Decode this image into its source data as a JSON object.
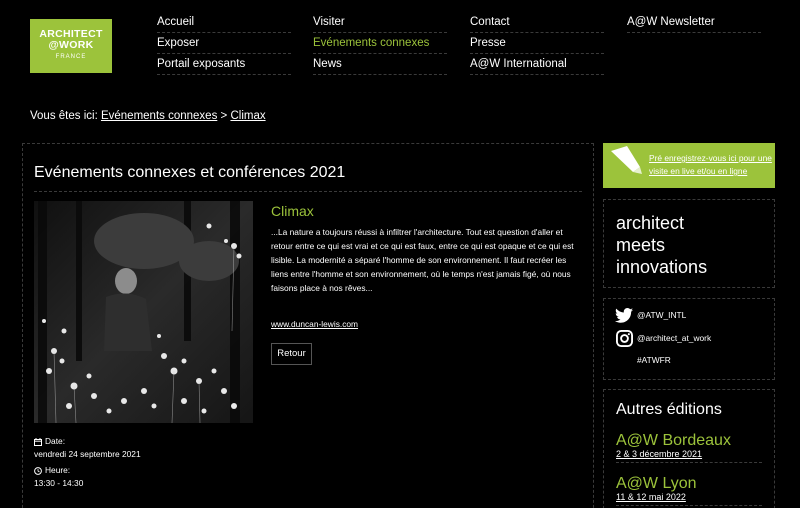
{
  "logo": {
    "line1": "ARCHITECT",
    "line2": "@WORK",
    "line3": "FRANCE"
  },
  "nav": {
    "col1": [
      "Accueil",
      "Exposer",
      "Portail exposants"
    ],
    "col2": [
      "Visiter",
      "Evénements connexes",
      "News"
    ],
    "col3": [
      "Contact",
      "Presse",
      "A@W International"
    ],
    "col4": [
      "A@W Newsletter"
    ]
  },
  "breadcrumb": {
    "prefix": "Vous êtes ici:",
    "parent": "Evénements connexes",
    "separator": ">",
    "current": "Climax"
  },
  "main": {
    "heading": "Evénements connexes et conférences 2021",
    "event_title": "Climax",
    "description": "...La nature a toujours réussi à infiltrer l'architecture. Tout est question d'aller et retour entre ce qui est vrai et ce qui est faux, entre ce qui est opaque et ce qui est lisible. La modernité a séparé l'homme de son environnement. Il faut recréer les liens entre l'homme et son environnement, où le temps n'est jamais figé, où nous faisons place à nos rêves...",
    "link": "www.duncan-lewis.com",
    "back_button": "Retour",
    "date_label": "Date:",
    "date_value": "vendredi 24 septembre 2021",
    "time_label": "Heure:",
    "time_value": "13:30 - 14:30"
  },
  "sidebar": {
    "promo": "Pré enregistrez-vous ici pour une visite en live et/ou en ligne",
    "tagline": [
      "architect",
      "meets",
      "innovations"
    ],
    "twitter": "@ATW_INTL",
    "instagram": "@architect_at_work",
    "hashtag": "#ATWFR",
    "editions_title": "Autres éditions",
    "editions": [
      {
        "name": "A@W Bordeaux",
        "date": "2 & 3 décembre 2021"
      },
      {
        "name": "A@W Lyon",
        "date": "11 & 12 mai 2022"
      }
    ]
  },
  "colors": {
    "accent": "#9cc33b",
    "background": "#000000",
    "divider": "#3a3a3a"
  }
}
